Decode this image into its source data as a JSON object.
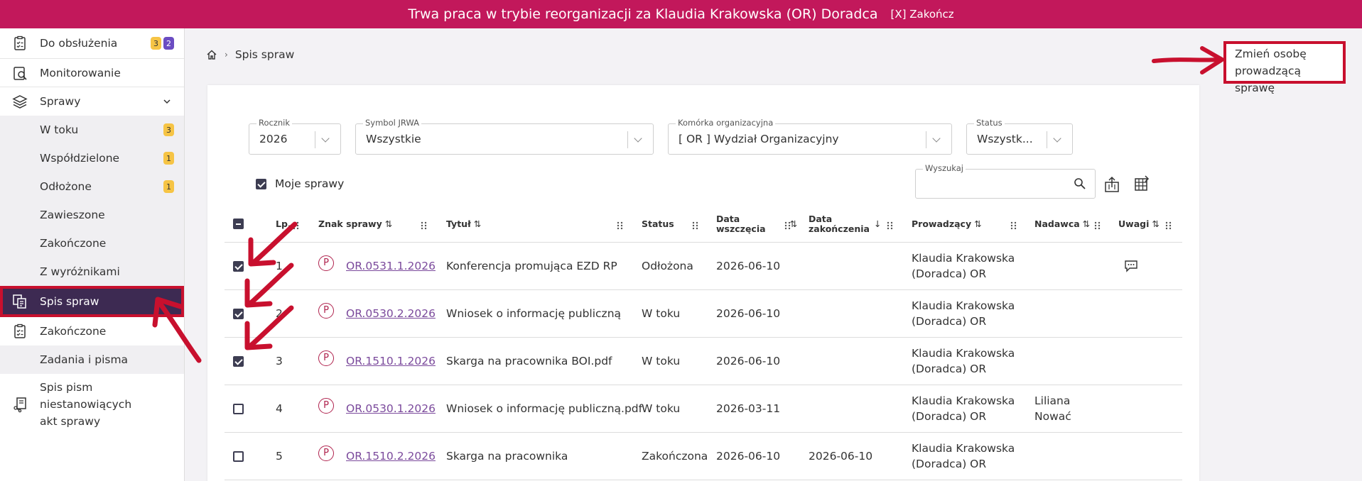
{
  "banner": {
    "text": "Trwa praca w trybie reorganizacji za Klaudia Krakowska (OR) Doradca",
    "end_label": "[X] Zakończ"
  },
  "sidebar": {
    "items": [
      {
        "label": "Do obsłużenia",
        "badges": [
          "3",
          "2"
        ]
      },
      {
        "label": "Monitorowanie"
      },
      {
        "label": "Sprawy"
      },
      {
        "label": "W toku",
        "badge": "3"
      },
      {
        "label": "Współdzielone",
        "badge": "1"
      },
      {
        "label": "Odłożone",
        "badge": "1"
      },
      {
        "label": "Zawieszone"
      },
      {
        "label": "Zakończone"
      },
      {
        "label": "Z wyróżnikami"
      },
      {
        "label": "Spis spraw"
      },
      {
        "label": "Zakończone"
      },
      {
        "label": "Zadania i pisma"
      },
      {
        "label": "Spis pism niestanowiących akt sprawy"
      }
    ]
  },
  "breadcrumb": {
    "home_icon": "home-icon",
    "current": "Spis spraw"
  },
  "change_button": "Zmień osobę prowadzącą sprawę",
  "filters": {
    "rocznik": {
      "label": "Rocznik",
      "value": "2026"
    },
    "symbol": {
      "label": "Symbol JRWA",
      "value": "Wszystkie"
    },
    "komorka": {
      "label": "Komórka organizacyjna",
      "value": "[ OR ] Wydział Organizacyjny"
    },
    "status": {
      "label": "Status",
      "value": "Wszystk..."
    },
    "search": {
      "label": "Wyszukaj",
      "value": ""
    },
    "moje_sprawy": {
      "label": "Moje sprawy",
      "checked": true
    }
  },
  "table": {
    "headers": {
      "lp": "Lp.",
      "znak": "Znak sprawy",
      "tytul": "Tytuł",
      "status": "Status",
      "data_wszczecia_1": "Data",
      "data_wszczecia_2": "wszczęcia",
      "data_zak_1": "Data",
      "data_zak_2": "zakończenia",
      "prowadzacy": "Prowadzący",
      "nadawca": "Nadawca",
      "uwagi": "Uwagi"
    },
    "rows": [
      {
        "checked": true,
        "lp": "1",
        "znak": "OR.0531.1.2026",
        "tytul": "Konferencja promująca EZD RP",
        "status": "Odłożona",
        "data_w": "2026-06-10",
        "data_z": "",
        "prow1": "Klaudia Krakowska",
        "prow2": "(Doradca) OR",
        "nad1": "",
        "nad2": "",
        "uwagi": true
      },
      {
        "checked": true,
        "lp": "2",
        "znak": "OR.0530.2.2026",
        "tytul": "Wniosek o informację publiczną",
        "status": "W toku",
        "data_w": "2026-06-10",
        "data_z": "",
        "prow1": "Klaudia Krakowska",
        "prow2": "(Doradca) OR",
        "nad1": "",
        "nad2": "",
        "uwagi": false
      },
      {
        "checked": true,
        "lp": "3",
        "znak": "OR.1510.1.2026",
        "tytul": "Skarga na pracownika BOI.pdf",
        "status": "W toku",
        "data_w": "2026-06-10",
        "data_z": "",
        "prow1": "Klaudia Krakowska",
        "prow2": "(Doradca) OR",
        "nad1": "",
        "nad2": "",
        "uwagi": false
      },
      {
        "checked": false,
        "lp": "4",
        "znak": "OR.0530.1.2026",
        "tytul": "Wniosek o informację publiczną.pdf",
        "status": "W toku",
        "data_w": "2026-03-11",
        "data_z": "",
        "prow1": "Klaudia Krakowska",
        "prow2": "(Doradca) OR",
        "nad1": "Liliana",
        "nad2": "Nować",
        "uwagi": false
      },
      {
        "checked": false,
        "lp": "5",
        "znak": "OR.1510.2.2026",
        "tytul": "Skarga na pracownika",
        "status": "Zakończona",
        "data_w": "2026-06-10",
        "data_z": "2026-06-10",
        "prow1": "Klaudia Krakowska",
        "prow2": "(Doradca) OR",
        "nad1": "",
        "nad2": "",
        "uwagi": false
      }
    ]
  },
  "colors": {
    "banner": "#c2185b",
    "active_nav": "#3d2a52",
    "highlight": "#c8102e",
    "link": "#7b4a9c",
    "badge_yellow": "#f6c445",
    "badge_purple": "#6b4cc2"
  }
}
